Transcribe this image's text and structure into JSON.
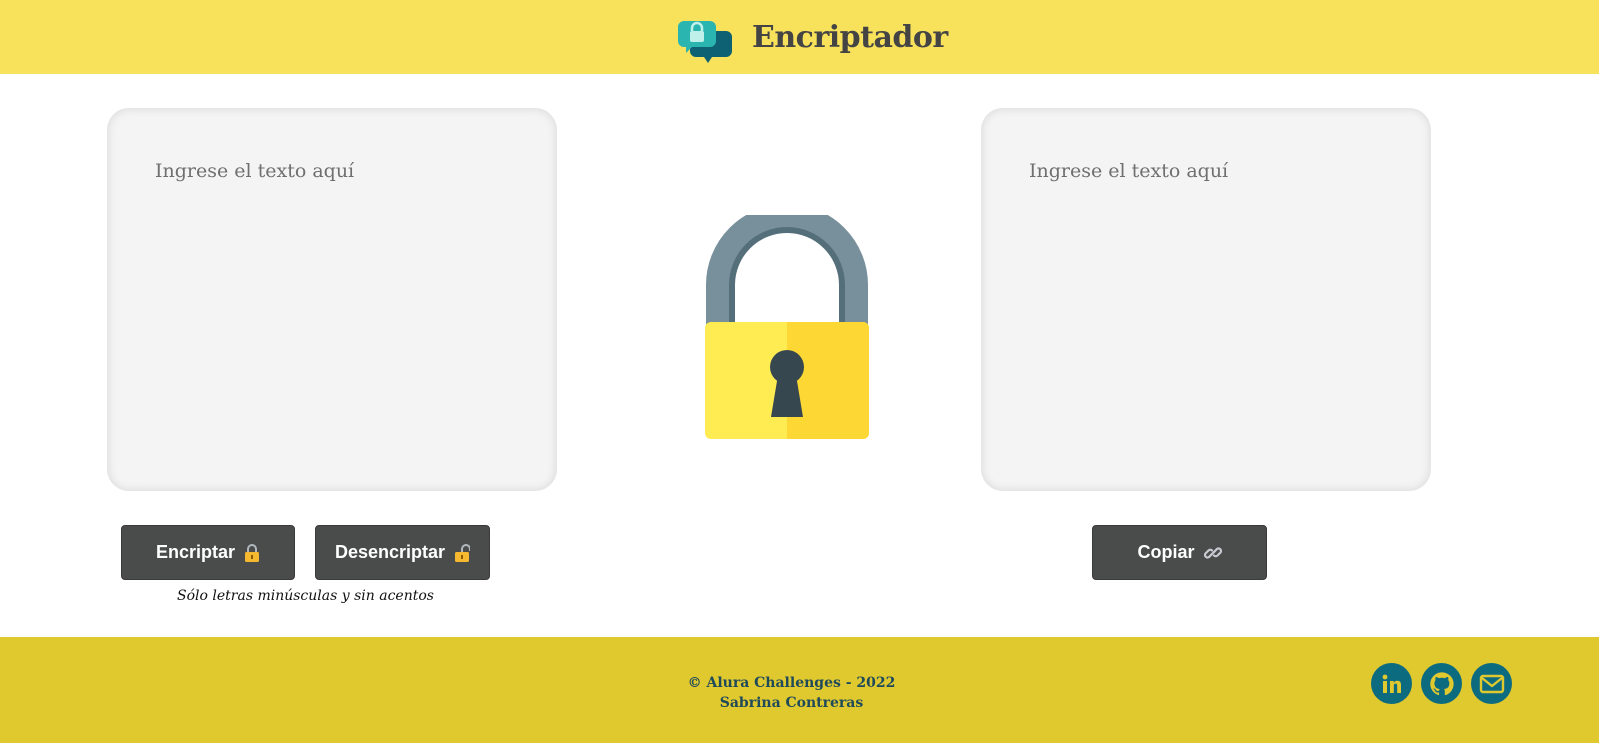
{
  "header": {
    "title": "Encriptador",
    "logo_icon": "chat-lock-icon"
  },
  "input": {
    "placeholder": "Ingrese el texto aquí",
    "value": ""
  },
  "output": {
    "placeholder": "Ingrese el texto aquí",
    "value": ""
  },
  "illustration": {
    "icon": "padlock-icon"
  },
  "actions": {
    "encrypt_label": "Encriptar",
    "encrypt_icon": "lock-closed-icon",
    "decrypt_label": "Desencriptar",
    "decrypt_icon": "lock-open-icon",
    "copy_label": "Copiar",
    "copy_icon": "link-icon"
  },
  "hint": "Sólo letras minúsculas y sin acentos",
  "footer": {
    "copyright": "© Alura Challenges - 2022",
    "author": "Sabrina Contreras",
    "social": [
      "linkedin-icon",
      "github-icon",
      "email-icon"
    ]
  },
  "colors": {
    "header_bg": "#f8e15b",
    "footer_bg": "#e0c92f",
    "button_bg": "#4a4b4b",
    "textbox_bg": "#f4f4f4",
    "social_bg": "#0d6b80",
    "lock_body_light": "#ffeb52",
    "lock_body_dark": "#fdd835",
    "lock_shackle": "#607d8b"
  }
}
